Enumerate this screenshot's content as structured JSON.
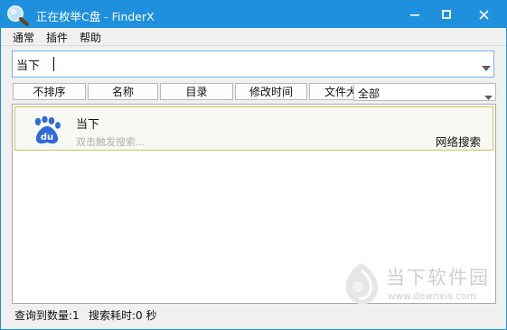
{
  "window": {
    "title": "正在枚举C盘  -  FinderX",
    "accent_color": "#1e90dd"
  },
  "menu": {
    "items": [
      {
        "label": "通常"
      },
      {
        "label": "插件"
      },
      {
        "label": "帮助"
      }
    ]
  },
  "search": {
    "value": "当下"
  },
  "columns": {
    "headers": [
      {
        "label": "不排序"
      },
      {
        "label": "名称"
      },
      {
        "label": "目录"
      },
      {
        "label": "修改时间"
      },
      {
        "label": "文件大"
      }
    ],
    "filter_selected": "全部"
  },
  "results": [
    {
      "icon": "baidu-paw-icon",
      "title": "当下",
      "hint": "双击触发搜索...",
      "action": "网络搜索"
    }
  ],
  "status": {
    "count_text": "查询到数量:1",
    "time_text": "搜索耗时:0 秒"
  },
  "watermark": {
    "brand": "当下软件园",
    "url": "www.downxia.com"
  }
}
